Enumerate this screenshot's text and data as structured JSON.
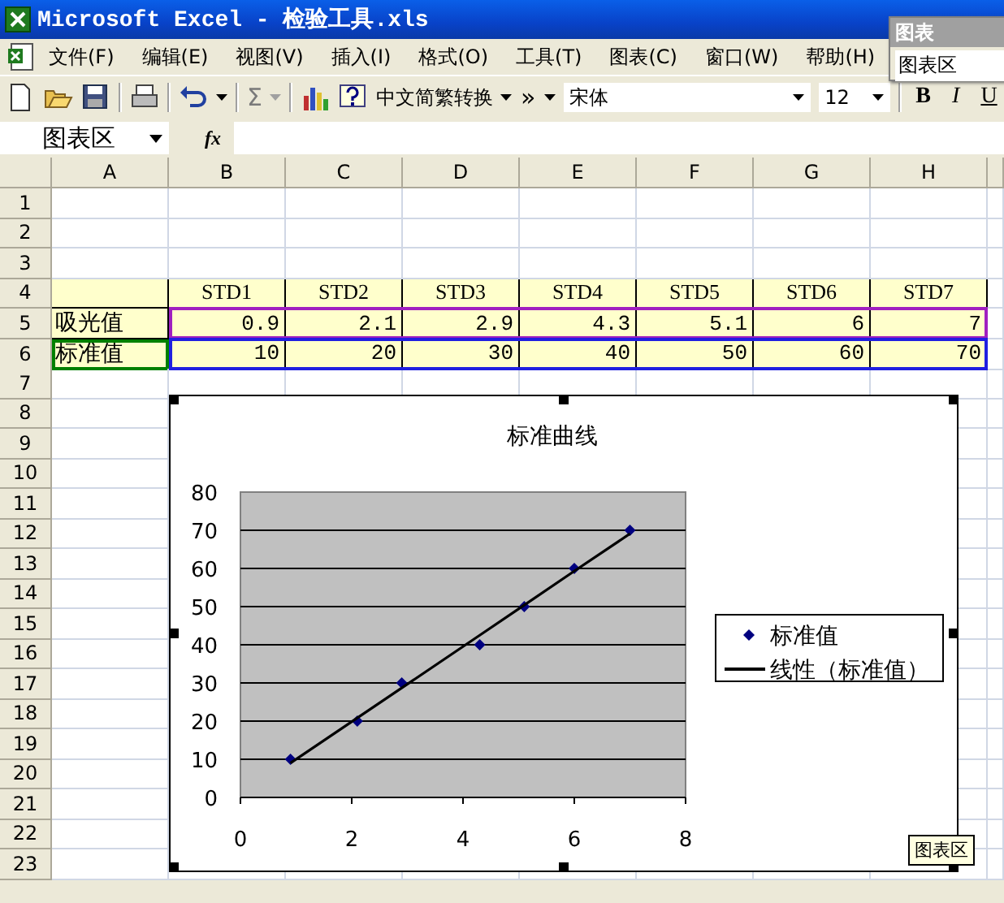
{
  "window": {
    "title": "Microsoft Excel - 检验工具.xls"
  },
  "menu": [
    "文件(F)",
    "编辑(E)",
    "视图(V)",
    "插入(I)",
    "格式(O)",
    "工具(T)",
    "图表(C)",
    "窗口(W)",
    "帮助(H)"
  ],
  "toolbar": {
    "items": [
      {
        "kind": "new",
        "disabled": false
      },
      {
        "kind": "open",
        "disabled": false
      },
      {
        "kind": "save",
        "disabled": false
      },
      {
        "kind": "sep"
      },
      {
        "kind": "print",
        "disabled": false
      },
      {
        "kind": "sep"
      },
      {
        "kind": "undo",
        "disabled": false,
        "dropdown": true
      },
      {
        "kind": "sep"
      },
      {
        "kind": "glyph",
        "text": "Σ",
        "disabled": true,
        "dropdown": true
      },
      {
        "kind": "sep"
      },
      {
        "kind": "chart",
        "disabled": false
      },
      {
        "kind": "help",
        "disabled": false
      },
      {
        "kind": "text",
        "text": "中文简繁转换",
        "disabled": false,
        "dropdown": true
      },
      {
        "kind": "glyph",
        "text": "»",
        "disabled": false,
        "dropdown": true
      }
    ],
    "font": "宋体",
    "size": "12",
    "format_buttons": [
      "B",
      "I",
      "U"
    ]
  },
  "formula_bar": {
    "name_box": "图表区",
    "fx": "fx"
  },
  "chart_toolbar": {
    "title": "图表",
    "selection": "图表区"
  },
  "sheet": {
    "columns": [
      "A",
      "B",
      "C",
      "D",
      "E",
      "F",
      "G",
      "H"
    ],
    "rows": [
      {
        "header": "1",
        "filled": false
      },
      {
        "header": "2",
        "filled": false
      },
      {
        "header": "3",
        "filled": false
      },
      {
        "header": "4",
        "filled": true,
        "cells": [
          {
            "kind": "blank"
          },
          {
            "kind": "header",
            "text": "STD1"
          },
          {
            "kind": "header",
            "text": "STD2"
          },
          {
            "kind": "header",
            "text": "STD3"
          },
          {
            "kind": "header",
            "text": "STD4"
          },
          {
            "kind": "header",
            "text": "STD5"
          },
          {
            "kind": "header",
            "text": "STD6"
          },
          {
            "kind": "header",
            "text": "STD7"
          }
        ]
      },
      {
        "header": "5",
        "filled": true,
        "color": "#a020c0",
        "cells": [
          {
            "kind": "label",
            "text": "吸光值"
          },
          {
            "kind": "number",
            "text": "0.9"
          },
          {
            "kind": "number",
            "text": "2.1"
          },
          {
            "kind": "number",
            "text": "2.9"
          },
          {
            "kind": "number",
            "text": "4.3"
          },
          {
            "kind": "number",
            "text": "5.1"
          },
          {
            "kind": "number",
            "text": "6"
          },
          {
            "kind": "number",
            "text": "7"
          }
        ]
      },
      {
        "header": "6",
        "filled": true,
        "color": "#2020e0",
        "cells": [
          {
            "kind": "label",
            "text": "标准值",
            "color": "#008000"
          },
          {
            "kind": "number",
            "text": "10"
          },
          {
            "kind": "number",
            "text": "20"
          },
          {
            "kind": "number",
            "text": "30"
          },
          {
            "kind": "number",
            "text": "40"
          },
          {
            "kind": "number",
            "text": "50"
          },
          {
            "kind": "number",
            "text": "60"
          },
          {
            "kind": "number",
            "text": "70"
          }
        ]
      },
      {
        "header": "7",
        "filled": false
      },
      {
        "header": "8",
        "filled": false
      },
      {
        "header": "9",
        "filled": false
      },
      {
        "header": "10",
        "filled": false
      },
      {
        "header": "11",
        "filled": false
      },
      {
        "header": "12",
        "filled": false
      },
      {
        "header": "13",
        "filled": false
      },
      {
        "header": "14",
        "filled": false
      },
      {
        "header": "15",
        "filled": false
      },
      {
        "header": "16",
        "filled": false
      },
      {
        "header": "17",
        "filled": false
      },
      {
        "header": "18",
        "filled": false
      },
      {
        "header": "19",
        "filled": false
      },
      {
        "header": "20",
        "filled": false
      },
      {
        "header": "21",
        "filled": false
      },
      {
        "header": "22",
        "filled": false
      },
      {
        "header": "23",
        "filled": false
      }
    ]
  },
  "chart": {
    "tooltip": "图表区",
    "chart_data": {
      "type": "scatter",
      "title": "标准曲线",
      "x": [
        0.9,
        2.1,
        2.9,
        4.3,
        5.1,
        6,
        7
      ],
      "series": [
        {
          "name": "标准值",
          "color": "#000080",
          "values": [
            10,
            20,
            30,
            40,
            50,
            60,
            70
          ]
        },
        {
          "name": "线性（标准值）",
          "type": "line",
          "color": "#000000",
          "values": [
            9.0,
            20.8,
            28.7,
            42.5,
            50.4,
            59.3,
            69.1
          ]
        }
      ],
      "grid": true,
      "legend": "right",
      "xlim": [
        0,
        8
      ],
      "ylim": [
        0,
        80
      ],
      "xticks": [
        0,
        2,
        4,
        6,
        8
      ],
      "yticks": [
        0,
        10,
        20,
        30,
        40,
        50,
        60,
        70,
        80
      ]
    }
  }
}
